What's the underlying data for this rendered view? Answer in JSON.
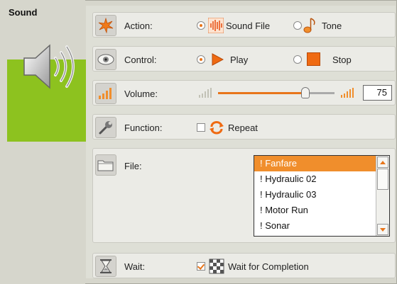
{
  "block": {
    "title": "Sound"
  },
  "action": {
    "label": "Action:",
    "options": [
      {
        "label": "Sound File",
        "selected": true,
        "icon": "sound-file-icon"
      },
      {
        "label": "Tone",
        "selected": false,
        "icon": "tone-icon"
      }
    ]
  },
  "control": {
    "label": "Control:",
    "options": [
      {
        "label": "Play",
        "selected": true,
        "icon": "play-icon"
      },
      {
        "label": "Stop",
        "selected": false,
        "icon": "stop-icon"
      }
    ]
  },
  "volume": {
    "label": "Volume:",
    "value": "75",
    "level": 75,
    "min": 0,
    "max": 100
  },
  "function": {
    "label": "Function:",
    "repeat_label": "Repeat",
    "repeat_checked": false
  },
  "file": {
    "label": "File:",
    "items": [
      "! Fanfare",
      "! Hydraulic 02",
      "! Hydraulic 03",
      "! Motor Run",
      "! Sonar"
    ],
    "selected_index": 0
  },
  "wait": {
    "label": "Wait:",
    "option_label": "Wait for Completion",
    "checked": true
  },
  "colors": {
    "accent": "#e8751a",
    "block_green": "#8dc21f",
    "selection": "#f08e2c"
  }
}
